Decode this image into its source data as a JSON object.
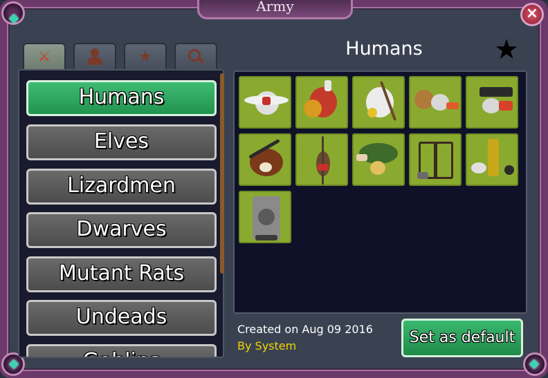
{
  "window": {
    "title": "Army",
    "close_label": "⊗"
  },
  "tabs": [
    {
      "icon": "crossed-swords-icon",
      "glyph": "⚔"
    },
    {
      "icon": "person-icon",
      "glyph": "👤"
    },
    {
      "icon": "star-icon",
      "glyph": "★"
    },
    {
      "icon": "magnifier-icon",
      "glyph": "🔍"
    }
  ],
  "races": [
    {
      "label": "Humans",
      "selected": true
    },
    {
      "label": "Elves",
      "selected": false
    },
    {
      "label": "Lizardmen",
      "selected": false
    },
    {
      "label": "Dwarves",
      "selected": false
    },
    {
      "label": "Mutant Rats",
      "selected": false
    },
    {
      "label": "Undeads",
      "selected": false
    },
    {
      "label": "Goblins",
      "selected": false
    }
  ],
  "army": {
    "title": "Humans",
    "favorite_glyph": "★",
    "units": [
      {
        "name": "winged-angel",
        "color": "#d8d8d8"
      },
      {
        "name": "axe-warrior-red-shield",
        "color": "#c43a2a"
      },
      {
        "name": "white-wizard",
        "color": "#e8e8e8"
      },
      {
        "name": "swordsman-helmet",
        "color": "#b06b2a"
      },
      {
        "name": "cannon-crew",
        "color": "#6b4a2a"
      },
      {
        "name": "musketeer",
        "color": "#8a4a2a"
      },
      {
        "name": "pikeman",
        "color": "#7a5a3a"
      },
      {
        "name": "archer",
        "color": "#4a7a3a"
      },
      {
        "name": "ballista",
        "color": "#5a4a3a"
      },
      {
        "name": "gold-cannon",
        "color": "#c8a81a"
      },
      {
        "name": "steam-tank",
        "color": "#9a9a9a"
      }
    ],
    "created": "Created on Aug 09 2016",
    "author": "By System",
    "set_default_label": "Set as default"
  }
}
